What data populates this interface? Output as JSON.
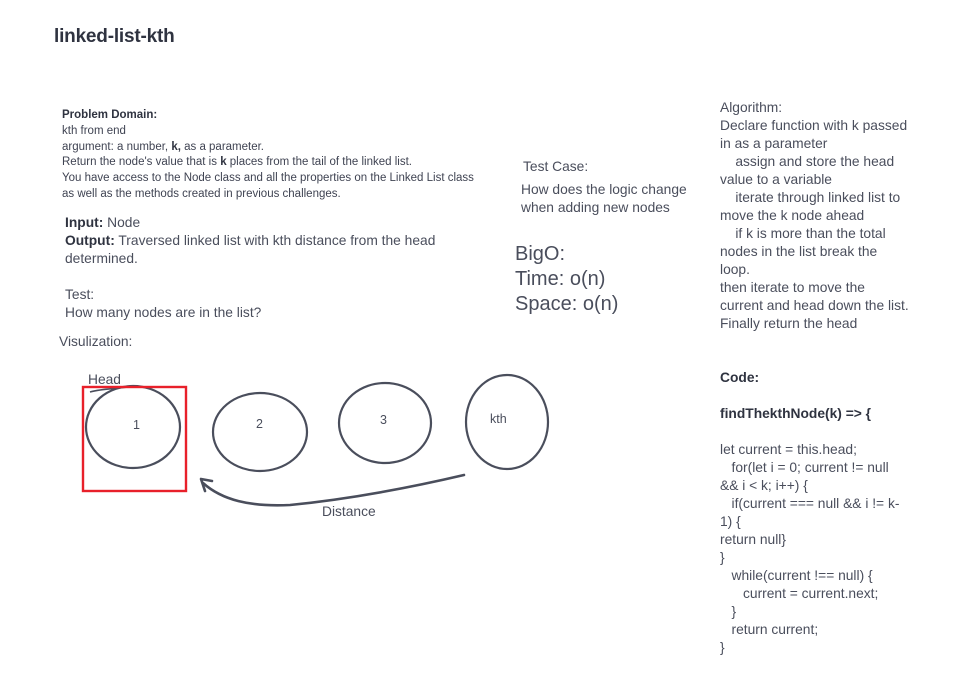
{
  "title": "linked-list-kth",
  "problem": {
    "heading": "Problem Domain:",
    "line1": "kth from end",
    "line2_pre": "argument: a number, ",
    "line2_bold": "k,",
    "line2_post": " as a parameter.",
    "line3_pre": "Return the node's value that is ",
    "line3_bold": "k",
    "line3_post": " places from the tail of the linked list.",
    "line4": "You have access to the Node class and all the properties on the Linked List class",
    "line5": "as well as the methods created in previous challenges."
  },
  "io": {
    "input_label": "Input:",
    "input_value": " Node",
    "output_label": "Output:",
    "output_value": " Traversed linked list with kth distance from the head determined."
  },
  "test": {
    "label": "Test:",
    "question": "How many nodes are in the list?"
  },
  "visualization": {
    "label": "Visulization:",
    "head_label": "Head",
    "distance_label": "Distance",
    "nodes": [
      "1",
      "2",
      "3",
      "kth"
    ],
    "highlight_color": "#e8202a"
  },
  "test_case": {
    "label": "Test Case:",
    "question": "How does the logic change when adding new nodes"
  },
  "bigo": {
    "label": "BigO:",
    "time": "Time: o(n)",
    "space": "Space: o(n)"
  },
  "algorithm": {
    "lines": [
      "Algorithm:",
      "Declare function with k passed in as a parameter",
      "    assign and store the head value to a variable",
      "    iterate through linked list to move the k node ahead",
      "    if k is more than the total nodes in the list break the loop.",
      "then iterate to move the current and head down the list.",
      "Finally return the head"
    ]
  },
  "code": {
    "label": "Code:",
    "signature": "findThekthNode(k) => {",
    "lines": [
      "let current = this.head;",
      "   for(let i = 0; current != null && i < k; i++) {",
      "   if(current === null && i != k-1) {",
      "return null}",
      "}",
      "   while(current !== null) {",
      "      current = current.next;",
      "   }",
      "   return current;",
      "}"
    ]
  }
}
